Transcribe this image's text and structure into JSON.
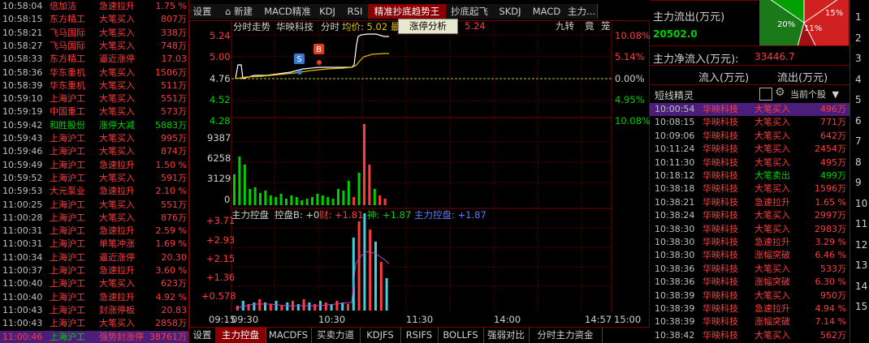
{
  "left_list": [
    {
      "time": "10:58:04",
      "name": "倍加洁",
      "action": "急速拉升",
      "value": "1.75 %",
      "name_color": "#ff3c3c",
      "action_color": "#ff3c3c",
      "value_color": "#ff3c3c"
    },
    {
      "time": "10:58:15",
      "name": "东方精工",
      "action": "大笔买入",
      "value": "807万",
      "name_color": "#ff3c3c",
      "action_color": "#ff3c3c",
      "value_color": "#ff3c3c"
    },
    {
      "time": "10:58:21",
      "name": "飞马国际",
      "action": "大笔买入",
      "value": "338万",
      "name_color": "#ff3c3c",
      "action_color": "#ff3c3c",
      "value_color": "#ff3c3c"
    },
    {
      "time": "10:58:27",
      "name": "飞马国际",
      "action": "大笔买入",
      "value": "748万",
      "name_color": "#ff3c3c",
      "action_color": "#ff3c3c",
      "value_color": "#ff3c3c"
    },
    {
      "time": "10:58:33",
      "name": "东方精工",
      "action": "逼近涨停",
      "value": "17.03",
      "name_color": "#ff3c3c",
      "action_color": "#ff3c3c",
      "value_color": "#ff3c3c"
    },
    {
      "time": "10:58:36",
      "name": "华东重机",
      "action": "大笔买入",
      "value": "1506万",
      "name_color": "#ff3c3c",
      "action_color": "#ff3c3c",
      "value_color": "#ff3c3c"
    },
    {
      "time": "10:58:39",
      "name": "华东重机",
      "action": "大笔买入",
      "value": "511万",
      "name_color": "#ff3c3c",
      "action_color": "#ff3c3c",
      "value_color": "#ff3c3c"
    },
    {
      "time": "10:59:10",
      "name": "上海沪工",
      "action": "大笔买入",
      "value": "551万",
      "name_color": "#ff3c3c",
      "action_color": "#ff3c3c",
      "value_color": "#ff3c3c"
    },
    {
      "time": "10:59:19",
      "name": "中国重工",
      "action": "大笔买入",
      "value": "573万",
      "name_color": "#ff3c3c",
      "action_color": "#ff3c3c",
      "value_color": "#ff3c3c"
    },
    {
      "time": "10:59:42",
      "name": "和胜股份",
      "action": "涨停大减",
      "value": "5883万",
      "name_color": "#00d000",
      "action_color": "#00d000",
      "value_color": "#00d000"
    },
    {
      "time": "10:59:43",
      "name": "上海沪工",
      "action": "大笔买入",
      "value": "995万",
      "name_color": "#ff3c3c",
      "action_color": "#ff3c3c",
      "value_color": "#ff3c3c"
    },
    {
      "time": "10:59:46",
      "name": "上海沪工",
      "action": "大笔买入",
      "value": "874万",
      "name_color": "#ff3c3c",
      "action_color": "#ff3c3c",
      "value_color": "#ff3c3c"
    },
    {
      "time": "10:59:49",
      "name": "上海沪工",
      "action": "急速拉升",
      "value": "1.50 %",
      "name_color": "#ff3c3c",
      "action_color": "#ff3c3c",
      "value_color": "#ff3c3c"
    },
    {
      "time": "10:59:52",
      "name": "上海沪工",
      "action": "大笔买入",
      "value": "591万",
      "name_color": "#ff3c3c",
      "action_color": "#ff3c3c",
      "value_color": "#ff3c3c"
    },
    {
      "time": "10:59:53",
      "name": "大元泵业",
      "action": "急速拉升",
      "value": "2.10 %",
      "name_color": "#ff3c3c",
      "action_color": "#ff3c3c",
      "value_color": "#ff3c3c"
    },
    {
      "time": "11:00:25",
      "name": "上海沪工",
      "action": "大笔买入",
      "value": "551万",
      "name_color": "#ff3c3c",
      "action_color": "#ff3c3c",
      "value_color": "#ff3c3c"
    },
    {
      "time": "11:00:28",
      "name": "上海沪工",
      "action": "大笔买入",
      "value": "876万",
      "name_color": "#ff3c3c",
      "action_color": "#ff3c3c",
      "value_color": "#ff3c3c"
    },
    {
      "time": "11:00:31",
      "name": "上海沪工",
      "action": "急速拉升",
      "value": "2.59 %",
      "name_color": "#ff3c3c",
      "action_color": "#ff3c3c",
      "value_color": "#ff3c3c"
    },
    {
      "time": "11:00:31",
      "name": "上海沪工",
      "action": "单笔冲涨",
      "value": "1.69 %",
      "name_color": "#ff3c3c",
      "action_color": "#ff3c3c",
      "value_color": "#ff3c3c"
    },
    {
      "time": "11:00:34",
      "name": "上海沪工",
      "action": "逼近涨停",
      "value": "20.30",
      "name_color": "#ff3c3c",
      "action_color": "#ff3c3c",
      "value_color": "#ff3c3c"
    },
    {
      "time": "11:00:37",
      "name": "上海沪工",
      "action": "急速拉升",
      "value": "3.60 %",
      "name_color": "#ff3c3c",
      "action_color": "#ff3c3c",
      "value_color": "#ff3c3c"
    },
    {
      "time": "11:00:40",
      "name": "上海沪工",
      "action": "大笔买入",
      "value": "623万",
      "name_color": "#ff3c3c",
      "action_color": "#ff3c3c",
      "value_color": "#ff3c3c"
    },
    {
      "time": "11:00:40",
      "name": "上海沪工",
      "action": "急速拉升",
      "value": "4.92 %",
      "name_color": "#ff3c3c",
      "action_color": "#ff3c3c",
      "value_color": "#ff3c3c"
    },
    {
      "time": "11:00:43",
      "name": "上海沪工",
      "action": "封涨停板",
      "value": "20.83",
      "name_color": "#ff3c3c",
      "action_color": "#ff3c3c",
      "value_color": "#ff3c3c"
    },
    {
      "time": "11:00:43",
      "name": "上海沪工",
      "action": "大笔买入",
      "value": "2858万",
      "name_color": "#ff3c3c",
      "action_color": "#ff3c3c",
      "value_color": "#ff3c3c"
    },
    {
      "time": "11:00:46",
      "name": "上海沪工",
      "action": "强势封涨停",
      "value": "38761万",
      "name_color": "#00d000",
      "action_color": "#ff3c3c",
      "value_color": "#ff3c3c",
      "highlight": true
    }
  ],
  "top_tabs": [
    {
      "label": "设置",
      "active": false
    },
    {
      "label": "新建",
      "active": false,
      "icon": "gamepad-icon"
    },
    {
      "label": "MACD精准",
      "active": false
    },
    {
      "label": "KDJ",
      "active": false
    },
    {
      "label": "RSI",
      "active": false
    },
    {
      "label": "精准抄底趋势王",
      "active": true
    },
    {
      "label": "抄底起飞",
      "active": false
    },
    {
      "label": "SKDJ",
      "active": false
    },
    {
      "label": "MACD",
      "active": false
    },
    {
      "label": "主力...",
      "active": false
    }
  ],
  "chart": {
    "header_title": "分时走势",
    "stock_name": "华映科技",
    "timeshare_label": "分时",
    "avg_label": "均价: 5.02",
    "avg_suffix": "最",
    "popup_label": "涨停分析",
    "price_right": "5.24",
    "buttons": [
      "九转",
      "竟",
      "笼"
    ],
    "price_axis_left": [
      "5.24",
      "5.00",
      "4.76",
      "4.52",
      "4.28"
    ],
    "price_axis_right": [
      "10.08%",
      "5.14%",
      "0.00%",
      "4.95%",
      "10.08%"
    ],
    "volume_axis": [
      "9387",
      "6258",
      "3129",
      "0"
    ],
    "indicator_header": {
      "title": "主力控盘",
      "b_label": "控盘B: +0",
      "cai": "财: +1.81",
      "shen": "神: +1.87",
      "zlkp": "主力控盘: +1.87"
    },
    "indicator_axis": [
      "+3.71",
      "+2.93",
      "+2.15",
      "+1.36",
      "+0.578"
    ],
    "time_labels": [
      "09:15",
      "09:30",
      "10:30",
      "11:30",
      "14:00",
      "14:57",
      "15:00"
    ],
    "markers": {
      "s": "S",
      "b": "B"
    }
  },
  "bottom_tabs": [
    {
      "label": "设置",
      "active": false
    },
    {
      "label": "主力控盘",
      "active": true
    },
    {
      "label": "MACDFS",
      "active": false
    },
    {
      "label": "买卖力道",
      "active": false
    },
    {
      "label": "KDJFS",
      "active": false
    },
    {
      "label": "RSIFS",
      "active": false
    },
    {
      "label": "BOLLFS",
      "active": false
    },
    {
      "label": "强弱对比",
      "active": false
    },
    {
      "label": "分时主力资金",
      "active": false
    }
  ],
  "right_panel": {
    "outflow_title": "主力流出(万元)",
    "outflow_value": "20502.0",
    "netinflow_label": "主力净流入(万元):",
    "netinflow_value": "33446.7",
    "pie_labels": [
      "20%",
      "11%",
      "15%"
    ],
    "flow_in_label": "流入(万元)",
    "flow_out_label": "流出(万元)",
    "sprite_title": "短线精灵",
    "current_stock_label": "当前个股",
    "rows": [
      {
        "time": "10:00:54",
        "name": "华映科技",
        "action": "大笔买入",
        "value": "496万",
        "action_color": "#ff3c3c",
        "value_color": "#ff3c3c",
        "highlight": true
      },
      {
        "time": "10:08:15",
        "name": "华映科技",
        "action": "大笔买入",
        "value": "771万",
        "action_color": "#ff3c3c",
        "value_color": "#ff3c3c"
      },
      {
        "time": "10:09:06",
        "name": "华映科技",
        "action": "大笔买入",
        "value": "642万",
        "action_color": "#ff3c3c",
        "value_color": "#ff3c3c"
      },
      {
        "time": "10:11:24",
        "name": "华映科技",
        "action": "大笔买入",
        "value": "2454万",
        "action_color": "#ff3c3c",
        "value_color": "#ff3c3c"
      },
      {
        "time": "10:11:30",
        "name": "华映科技",
        "action": "大笔买入",
        "value": "495万",
        "action_color": "#ff3c3c",
        "value_color": "#ff3c3c"
      },
      {
        "time": "10:18:12",
        "name": "华映科技",
        "action": "大笔卖出",
        "value": "499万",
        "action_color": "#00d000",
        "value_color": "#00d000"
      },
      {
        "time": "10:38:18",
        "name": "华映科技",
        "action": "大笔买入",
        "value": "1596万",
        "action_color": "#ff3c3c",
        "value_color": "#ff3c3c"
      },
      {
        "time": "10:38:21",
        "name": "华映科技",
        "action": "急速拉升",
        "value": "1.65 %",
        "action_color": "#ff3c3c",
        "value_color": "#ff3c3c"
      },
      {
        "time": "10:38:24",
        "name": "华映科技",
        "action": "大笔买入",
        "value": "2997万",
        "action_color": "#ff3c3c",
        "value_color": "#ff3c3c"
      },
      {
        "time": "10:38:30",
        "name": "华映科技",
        "action": "大笔买入",
        "value": "2983万",
        "action_color": "#ff3c3c",
        "value_color": "#ff3c3c"
      },
      {
        "time": "10:38:30",
        "name": "华映科技",
        "action": "急速拉升",
        "value": "3.29 %",
        "action_color": "#ff3c3c",
        "value_color": "#ff3c3c"
      },
      {
        "time": "10:38:30",
        "name": "华映科技",
        "action": "涨幅突破",
        "value": "6.46 %",
        "action_color": "#ff3c3c",
        "value_color": "#ff3c3c"
      },
      {
        "time": "10:38:36",
        "name": "华映科技",
        "action": "大笔买入",
        "value": "533万",
        "action_color": "#ff3c3c",
        "value_color": "#ff3c3c"
      },
      {
        "time": "10:38:36",
        "name": "华映科技",
        "action": "涨幅突破",
        "value": "6.30 %",
        "action_color": "#ff3c3c",
        "value_color": "#ff3c3c"
      },
      {
        "time": "10:38:39",
        "name": "华映科技",
        "action": "大笔买入",
        "value": "950万",
        "action_color": "#ff3c3c",
        "value_color": "#ff3c3c"
      },
      {
        "time": "10:38:39",
        "name": "华映科技",
        "action": "急速拉升",
        "value": "4.94 %",
        "action_color": "#ff3c3c",
        "value_color": "#ff3c3c"
      },
      {
        "time": "10:38:39",
        "name": "华映科技",
        "action": "涨幅突破",
        "value": "7.14 %",
        "action_color": "#ff3c3c",
        "value_color": "#ff3c3c"
      },
      {
        "time": "10:38:42",
        "name": "华映科技",
        "action": "大笔买入",
        "value": "562万",
        "action_color": "#ff3c3c",
        "value_color": "#ff3c3c"
      }
    ]
  },
  "far_right_numbers": [
    "1",
    "2",
    "3",
    "4",
    "5",
    "6",
    "7",
    "8",
    "9",
    "10",
    "11",
    "12",
    "13",
    "14",
    "15"
  ]
}
